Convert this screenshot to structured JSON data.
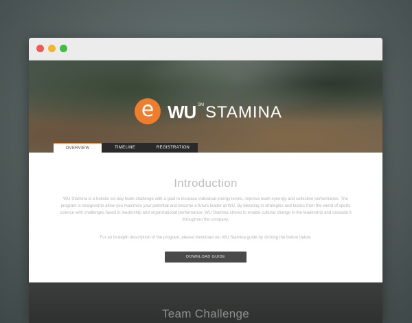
{
  "logo": {
    "mark": "e",
    "brand": "WU",
    "service_mark": "SM",
    "product": "STAMINA"
  },
  "tabs": [
    {
      "label": "OVERVIEW",
      "active": true
    },
    {
      "label": "TIMELINE",
      "active": false
    },
    {
      "label": "REGISTRATION",
      "active": false
    }
  ],
  "intro": {
    "title": "Introduction",
    "paragraph1": "WU Stamina is a holistic six-day team challenge with a goal to increase individual energy levels, improve team synergy and collective performance. The program is designed to allow you maximize your potential and become a future leader at WU. By blending in strategies and tactics from the world of sports science with challenges faced in leadership and organizational performance, WU Stamina strives to enable cultural change in the leadership and cascade it throughout the company.",
    "paragraph2": "For an in-depth description of the program, please download our WU Stamina guide by clicking the button below.",
    "button_label": "DOWNLOAD GUIDE"
  },
  "section2": {
    "title": "Team Challenge"
  },
  "colors": {
    "accent": "#ef7d2e",
    "tab_bar": "#2a2a2a",
    "button": "#4a4a4a"
  }
}
